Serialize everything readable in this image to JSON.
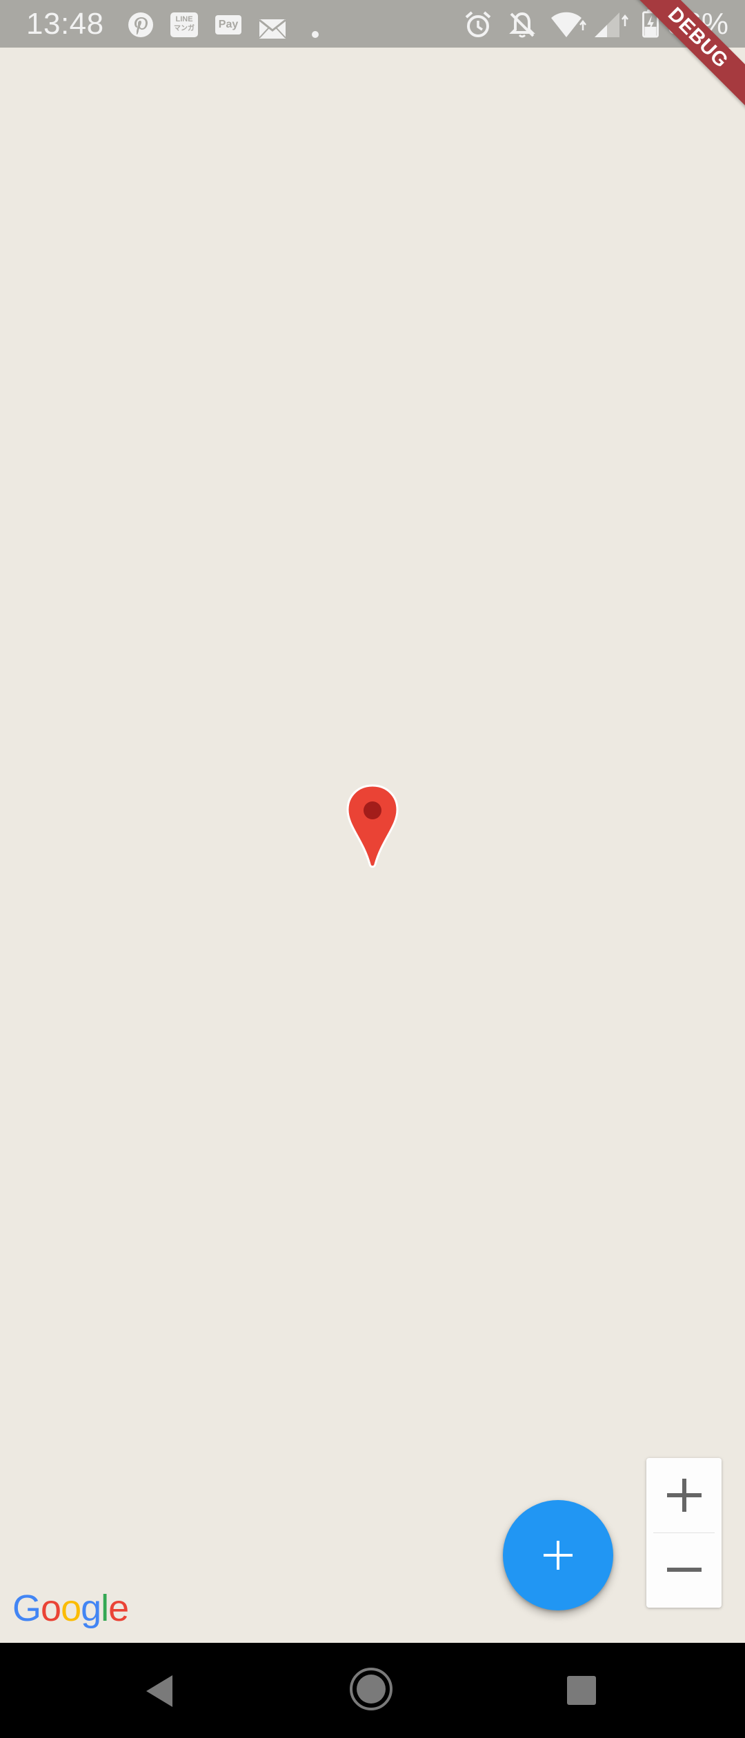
{
  "status_bar": {
    "time": "13:48",
    "battery_percent": "36%",
    "left_icons": [
      "pinterest-icon",
      "line-manga-icon",
      "pay-icon",
      "mail-icon",
      "dot-icon"
    ],
    "right_icons": [
      "alarm-icon",
      "notifications-off-icon",
      "wifi-icon",
      "signal-icon",
      "battery-charging-icon"
    ],
    "pay_label": "Pay",
    "line_label_top": "LINE",
    "line_label_bottom": "マンガ"
  },
  "debug_banner": {
    "label": "DEBUG",
    "color": "#a63a3f"
  },
  "map": {
    "background_color": "#ede9e1",
    "marker": {
      "icon": "map-pin-icon",
      "color": "#ea4335"
    },
    "attribution": {
      "letters": [
        "G",
        "o",
        "o",
        "g",
        "l",
        "e"
      ],
      "colors": [
        "#4285f4",
        "#ea4335",
        "#fbbc05",
        "#4285f4",
        "#34a853",
        "#ea4335"
      ]
    }
  },
  "zoom_controls": {
    "zoom_in_icon": "plus-icon",
    "zoom_out_icon": "minus-icon"
  },
  "fab": {
    "icon": "add-icon",
    "color": "#2196f3"
  },
  "nav_bar": {
    "back_icon": "back-triangle-icon",
    "home_icon": "home-circle-icon",
    "recents_icon": "recents-square-icon"
  }
}
